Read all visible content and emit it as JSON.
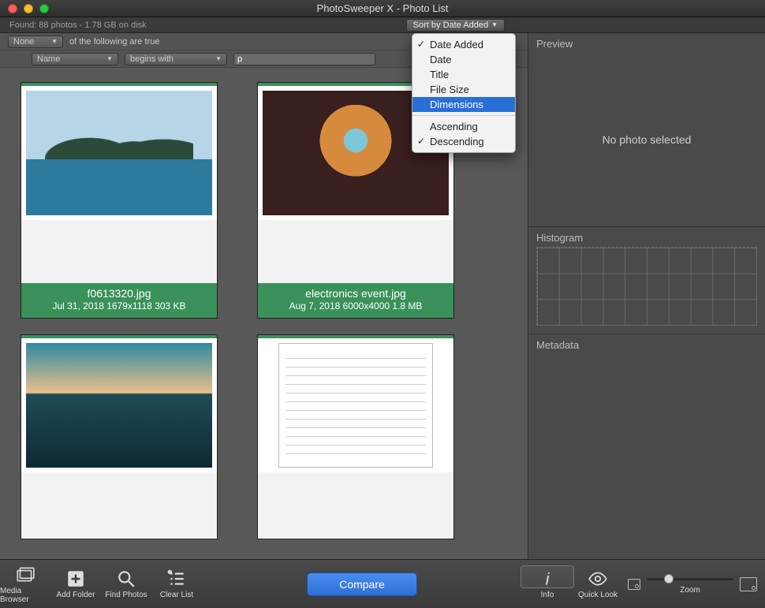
{
  "title": "PhotoSweeper X - Photo List",
  "status": "Found: 88 photos - 1.78 GB on disk",
  "sort_button": "Sort by Date Added",
  "filter": {
    "scope": "None",
    "scope_tail": "of the following are true",
    "field": "Name",
    "op": "begins with",
    "value": "p"
  },
  "menu": {
    "items": [
      "Date Added",
      "Date",
      "Title",
      "File Size",
      "Dimensions"
    ],
    "checked": "Date Added",
    "highlighted": "Dimensions",
    "order_items": [
      "Ascending",
      "Descending"
    ],
    "order_checked": "Descending"
  },
  "cards": [
    {
      "name": "f0613320.jpg",
      "meta": "Jul 31, 2018  1679x1118  303 KB",
      "thumb": "bay"
    },
    {
      "name": "electronics event.jpg",
      "meta": "Aug 7, 2018  6000x4000  1.8 MB",
      "thumb": "event"
    },
    {
      "name": "",
      "meta": "",
      "thumb": "beach"
    },
    {
      "name": "",
      "meta": "",
      "thumb": "doc"
    }
  ],
  "right": {
    "preview_title": "Preview",
    "preview_empty": "No photo selected",
    "hist_title": "Histogram",
    "meta_title": "Metadata"
  },
  "toolbar": {
    "media": "Media Browser",
    "add": "Add Folder",
    "find": "Find Photos",
    "clear": "Clear List",
    "compare": "Compare",
    "info": "Info",
    "quick": "Quick Look",
    "zoom": "Zoom"
  }
}
